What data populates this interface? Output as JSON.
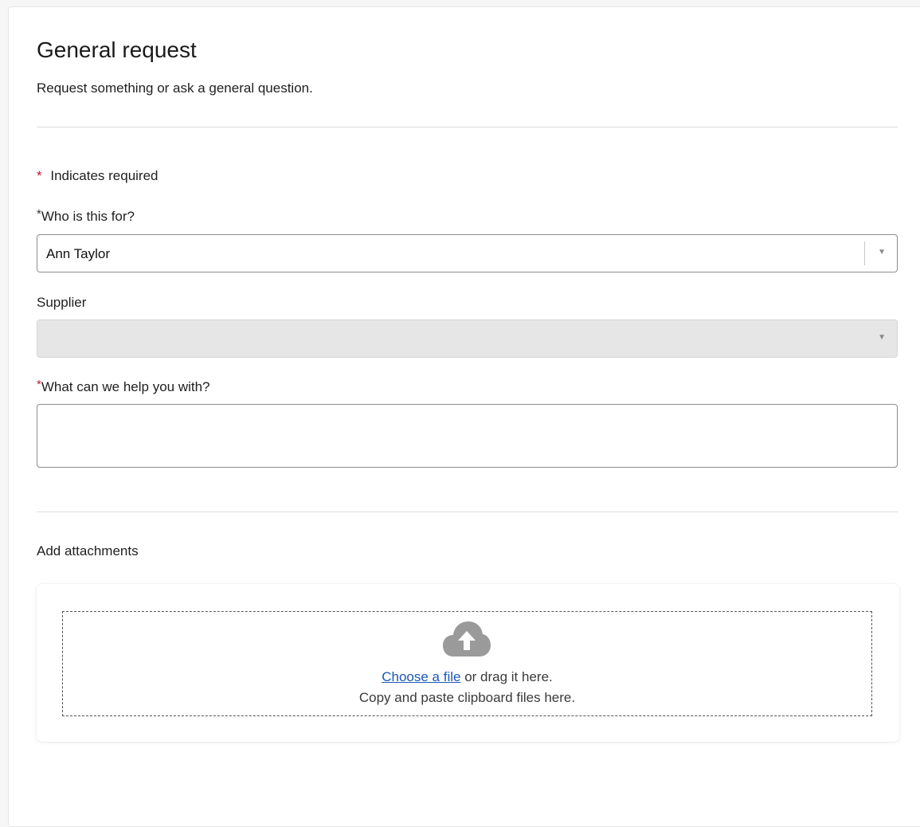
{
  "form": {
    "title": "General request",
    "description": "Request something or ask a general question.",
    "required_star": "*",
    "required_note": "Indicates required"
  },
  "fields": {
    "who_label": "Who is this for?",
    "who_value": "Ann Taylor",
    "supplier_label": "Supplier",
    "supplier_value": "",
    "help_label": "What can we help you with?",
    "help_value": "",
    "arrow_glyph": "▼"
  },
  "attachments": {
    "heading": "Add attachments",
    "choose_link": "Choose a file",
    "drag_text": " or drag it here.",
    "clipboard_text": "Copy and paste clipboard files here.",
    "icon": "cloud-upload-icon"
  },
  "colors": {
    "required": "#c8102e",
    "link": "#1a57b8",
    "disabled_bg": "#e6e6e6"
  }
}
